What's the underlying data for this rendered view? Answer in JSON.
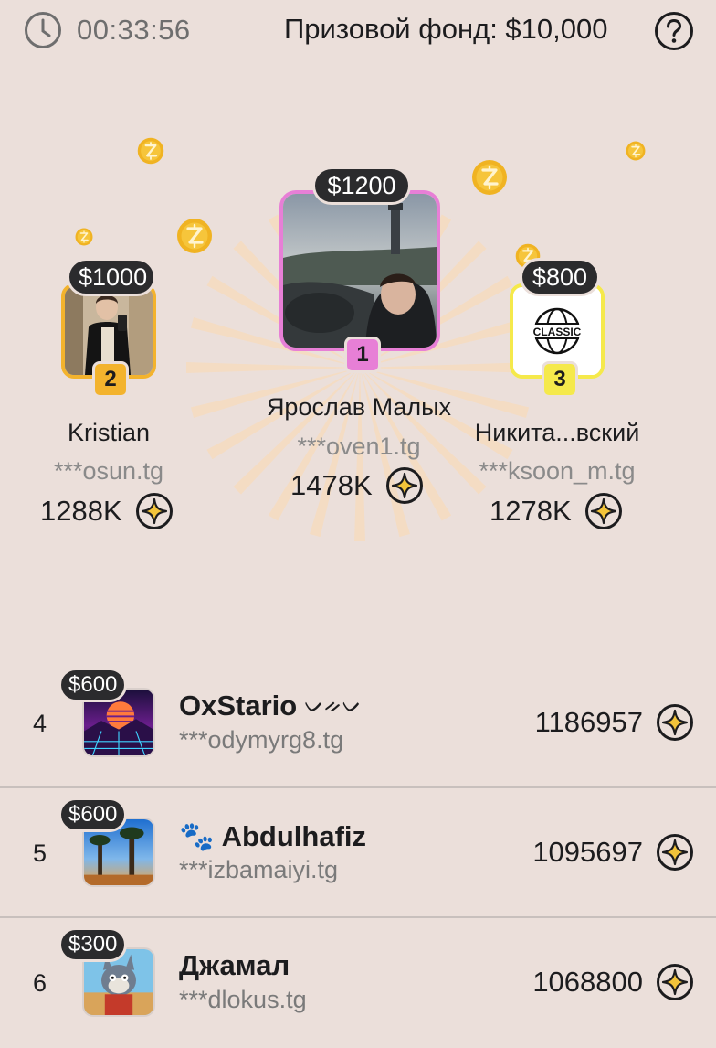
{
  "header": {
    "timer": "00:33:56",
    "prize_pool": "Призовой фонд: $10,000",
    "help_icon": "question-circle-icon",
    "clock_icon": "clock-icon"
  },
  "colors": {
    "background": "#ebdfda",
    "first_place": "#e77fd6",
    "second_place": "#f3b32d",
    "third_place": "#f5e94b",
    "pill": "#2b2b2d",
    "coin": "#f3b32d"
  },
  "podium": [
    {
      "rank": "1",
      "prize": "$1200",
      "name": "Ярослав Малых",
      "username": "***oven1.tg",
      "score": "1478K"
    },
    {
      "rank": "2",
      "prize": "$1000",
      "name": "Kristian",
      "username": "***osun.tg",
      "score": "1288K"
    },
    {
      "rank": "3",
      "prize": "$800",
      "name": "Никита...вский",
      "username": "***ksoon_m.tg",
      "score": "1278K",
      "avatar_text": "CLASSIC"
    }
  ],
  "list": [
    {
      "rank": "4",
      "prize": "$600",
      "name": "OxStario",
      "name_suffix": "ᨆᨀᨆ",
      "username": "***odymyrg8.tg",
      "score": "1186957"
    },
    {
      "rank": "5",
      "prize": "$600",
      "name_prefix": "🐾",
      "name": "Abdulhafiz",
      "username": "***izbamaiyi.tg",
      "score": "1095697"
    },
    {
      "rank": "6",
      "prize": "$300",
      "name": "Джамал",
      "username": "***dlokus.tg",
      "score": "1068800"
    }
  ]
}
